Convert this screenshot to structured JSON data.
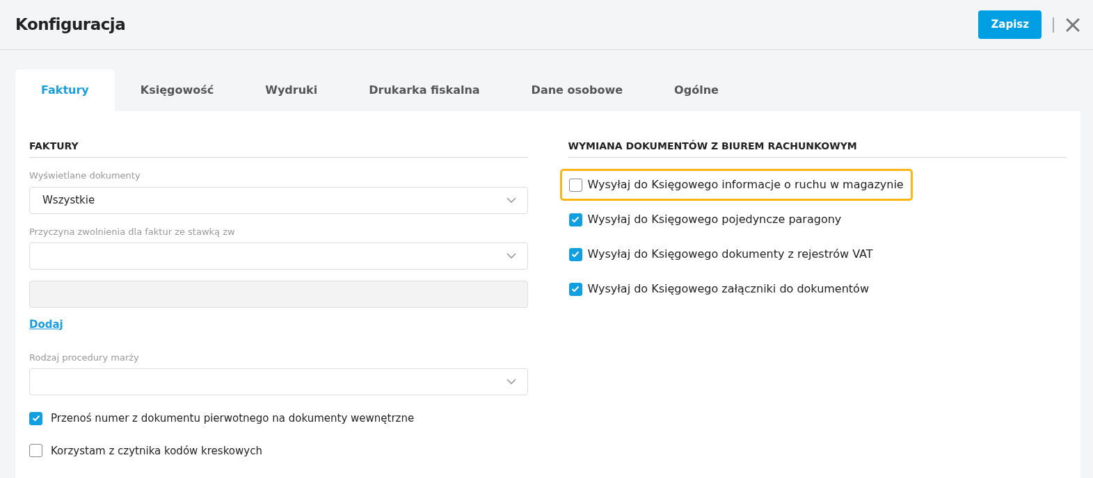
{
  "window": {
    "title": "Konfiguracja"
  },
  "header_buttons": {
    "save": "Zapisz"
  },
  "tabs": [
    {
      "label": "Faktury",
      "selected": true
    },
    {
      "label": "Księgowość",
      "selected": false
    },
    {
      "label": "Wydruki",
      "selected": false
    },
    {
      "label": "Drukarka fiskalna",
      "selected": false
    },
    {
      "label": "Dane osobowe",
      "selected": false
    },
    {
      "label": "Ogólne",
      "selected": false
    }
  ],
  "left_section": {
    "title": "FAKTURY",
    "items": [
      {
        "kind": "select",
        "label": "Wyświetlane dokumenty",
        "value": "Wszystkie"
      },
      {
        "kind": "select",
        "label": "Przyczyna zwolnienia dla faktur ze stawką zw"
      },
      {
        "kind": "input",
        "disabled": true
      },
      {
        "kind": "link",
        "text": "Dodaj"
      },
      {
        "kind": "select",
        "label": "Rodzaj procedury marży"
      },
      {
        "kind": "checkbox",
        "label": "Przenoś numer z dokumentu pierwotnego na dokumenty wewnętrzne",
        "checked": true
      },
      {
        "kind": "checkbox",
        "label": "Korzystam z czytnika kodów kreskowych",
        "checked": false
      }
    ]
  },
  "right_section": {
    "title": "WYMIANA DOKUMENTÓW Z BIUREM RACHUNKOWYM",
    "items": [
      {
        "label": "Wysyłaj do Księgowego informacje o ruchu w magazynie",
        "checked": false,
        "highlighted": true
      },
      {
        "label": "Wysyłaj do Księgowego pojedyncze paragony",
        "checked": true,
        "highlighted": false
      },
      {
        "label": "Wysyłaj do Księgowego dokumenty z rejestrów VAT",
        "checked": true,
        "highlighted": false
      },
      {
        "label": "Wysyłaj do Księgowego załączniki do dokumentów",
        "checked": true,
        "highlighted": false
      }
    ]
  }
}
